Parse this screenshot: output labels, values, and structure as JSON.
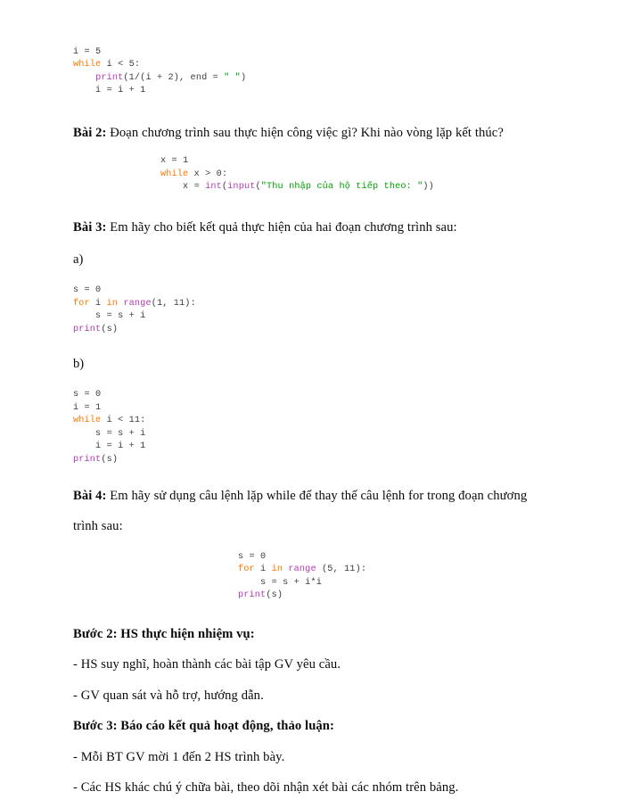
{
  "document": {
    "language": "vi",
    "page_background": "#ffffff",
    "text_color": "#0a0a0a",
    "code_colors": {
      "default": "#3c3c3c",
      "keyword": "#ff7700",
      "builtin_function": "#b33ab3",
      "string": "#00a000"
    }
  },
  "blocks": {
    "code_bai1": {
      "line1_var": "i = 5",
      "line2_kw": "while",
      "line2_rest": " i < 5:",
      "line3_indent": "    ",
      "line3_fn": "print",
      "line3_mid": "(1/(i + 2), end = ",
      "line3_str": "\" \"",
      "line3_end": ")",
      "line4": "    i = i + 1"
    },
    "bai2_heading_label": "Bài 2:",
    "bai2_heading_text": " Đoạn chương trình sau thực hiện công việc gì? Khi nào vòng lặp kết thúc?",
    "code_bai2": {
      "line1": "x = 1",
      "line2_kw": "while",
      "line2_rest": " x > 0:",
      "line3_indent": "    x = ",
      "line3_fn1": "int",
      "line3_mid1": "(",
      "line3_fn2": "input",
      "line3_mid2": "(",
      "line3_str": "\"Thu nhập của hộ tiếp theo: \"",
      "line3_end": "))"
    },
    "bai3_heading_label": "Bài 3:",
    "bai3_heading_text": " Em hãy cho biết kết quả thực hiện của hai đoạn chương trình sau:",
    "part_a_label": "a)",
    "code_bai3a": {
      "line1": "s = 0",
      "line2_kw1": "for",
      "line2_mid1": " i ",
      "line2_kw2": "in",
      "line2_mid2": " ",
      "line2_fn": "range",
      "line2_end": "(1, 11):",
      "line3": "    s = s + i",
      "line4_fn": "print",
      "line4_end": "(s)"
    },
    "part_b_label": "b)",
    "code_bai3b": {
      "line1": "s = 0",
      "line2": "i = 1",
      "line3_kw": "while",
      "line3_rest": " i < 11:",
      "line4": "    s = s + i",
      "line5": "    i = i + 1",
      "line6_fn": "print",
      "line6_end": "(s)"
    },
    "bai4_heading_label": "Bài 4:",
    "bai4_heading_text": " Em hãy sử dụng câu lệnh lặp while để thay thế câu lệnh for trong đoạn chương trình sau:",
    "code_bai4": {
      "line1": "s = 0",
      "line2_kw1": "for",
      "line2_mid1": " i ",
      "line2_kw2": "in",
      "line2_mid2": " ",
      "line2_fn": "range",
      "line2_end": " (5, 11):",
      "line3": "    s = s + i*i",
      "line4_fn": "print",
      "line4_end": "(s)"
    },
    "buoc2_heading": "Bước 2: HS thực hiện nhiệm vụ:",
    "buoc2_item1": "- HS suy nghĩ, hoàn thành các bài tập GV yêu cầu.",
    "buoc2_item2": "- GV quan sát và hỗ trợ, hướng dẫn.",
    "buoc3_heading": "Bước 3: Báo cáo kết quả hoạt động, thảo luận:",
    "buoc3_item1": "- Mỗi BT GV mời 1 đến 2 HS trình bày.",
    "buoc3_item2": "- Các HS khác chú ý chữa bài, theo dõi nhận xét bài các nhóm trên bảng."
  }
}
